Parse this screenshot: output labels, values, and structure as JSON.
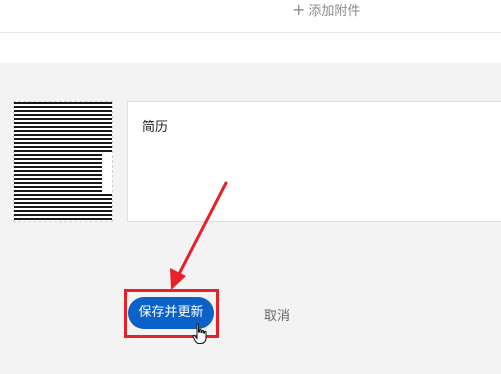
{
  "top": {
    "add_attachment_label": "添加附件",
    "add_attachment_icon": "plus-icon"
  },
  "resume": {
    "label": "简历"
  },
  "actions": {
    "save_label": "保存并更新",
    "cancel_label": "取消"
  },
  "colors": {
    "accent": "#0a61c9",
    "highlight": "#e8202a",
    "background": "#f3f3f3"
  }
}
